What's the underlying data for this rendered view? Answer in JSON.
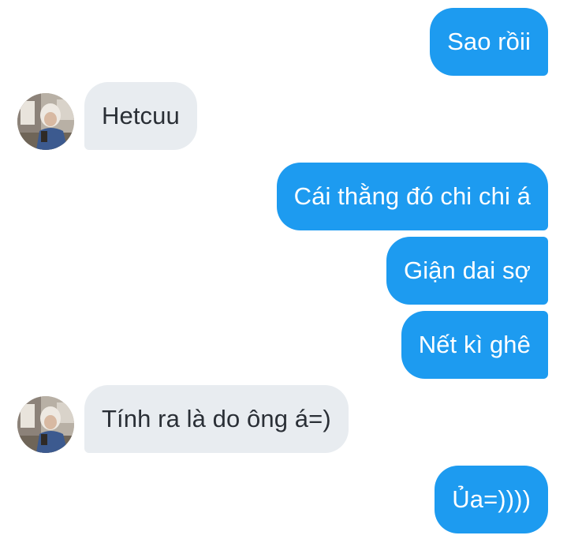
{
  "conversation": {
    "messages": [
      {
        "sender": "me",
        "text": "Sao rồii"
      },
      {
        "sender": "other",
        "text": "Hetcuu",
        "avatar": "contact-avatar"
      },
      {
        "sender": "me",
        "text": "Cái thằng đó chi chi á"
      },
      {
        "sender": "me",
        "text": "Giận dai sợ"
      },
      {
        "sender": "me",
        "text": "Nết kì ghê"
      },
      {
        "sender": "other",
        "text": "Tính ra là do ông á=)",
        "avatar": "contact-avatar"
      },
      {
        "sender": "me",
        "text": "Ủa=))))"
      }
    ]
  },
  "colors": {
    "outgoing_bubble": "#1d9bf0",
    "incoming_bubble": "#e8ecf0",
    "outgoing_text": "#ffffff",
    "incoming_text": "#2a2f36"
  }
}
